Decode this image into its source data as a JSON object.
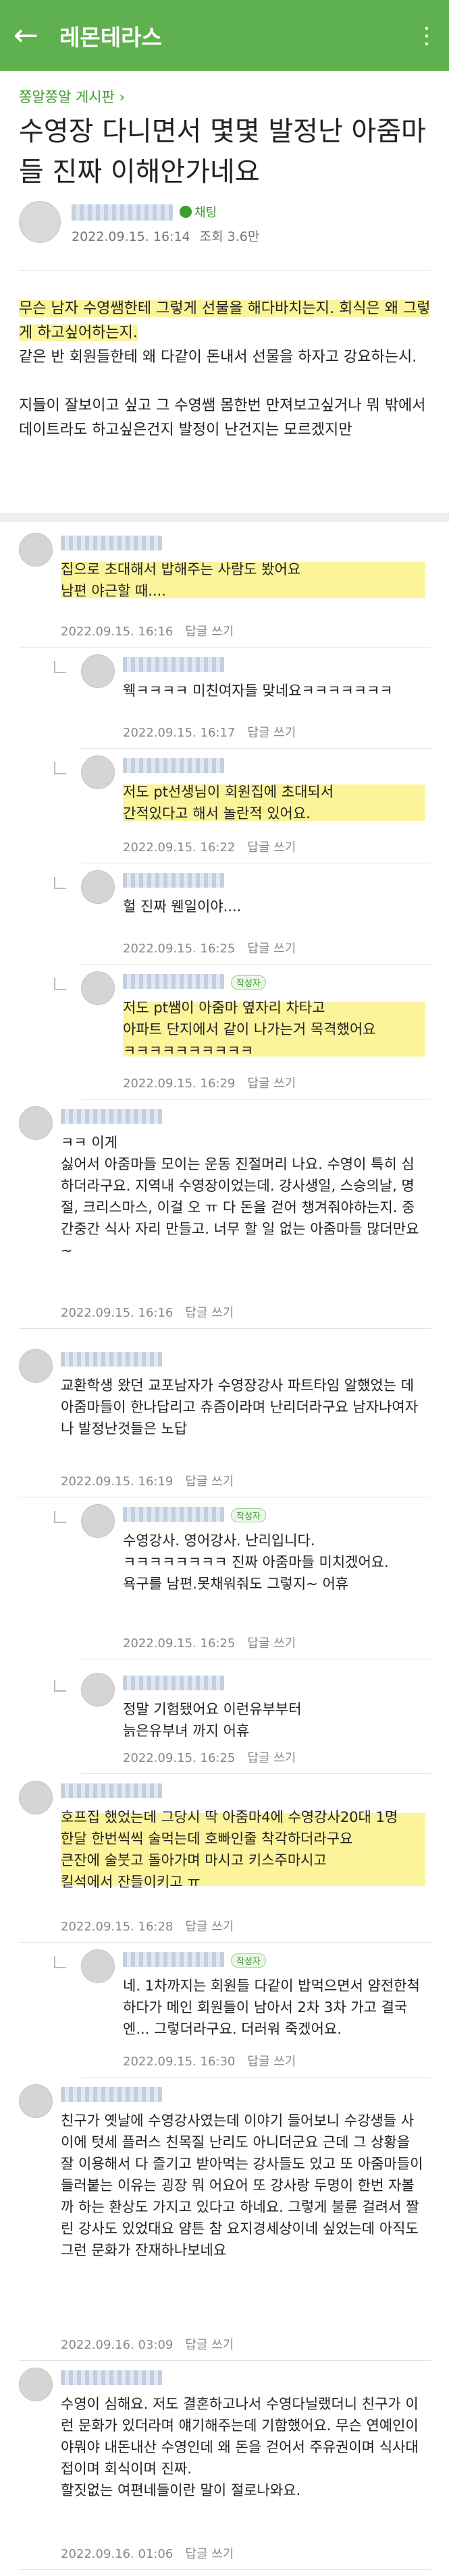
{
  "appbar": {
    "title": "레몬테라스",
    "back_icon": "arrow-left-icon",
    "more_icon": "kebab-menu-icon"
  },
  "post": {
    "board": "쫑알쫑알 게시판 ›",
    "title": "수영장 다니면서 몇몇 발정난 아줌마들 진짜 이해안가네요",
    "chat_label": "채팅",
    "date": "2022.09.15. 16:14",
    "views": "조회 3.6만",
    "body": [
      "무슨 남자 수영쌤한테 그렇게 선물을 해다바치는지. 회식은 왜 그렇게 하고싶어하는지.",
      "같은 반 회원들한테 왜 다같이 돈내서 선물을 하자고 강요하는시.",
      "지들이 잘보이고 싶고 그 수영쌤 몸한번 만져보고싶거나 뭐 밖에서 데이트라도 하고싶은건지 발정이 난건지는 모르겠지만"
    ]
  },
  "comments": [
    {
      "text": "집으로 초대해서 밥해주는 사람도 봤어요\n남편 야근할 때....",
      "date": "2022.09.15. 16:16",
      "reply": "답글 쓰기",
      "nested": false,
      "badge": ""
    },
    {
      "text": "웩ㅋㅋㅋㅋ 미친여자들 맞네요ㅋㅋㅋㅋㅋㅋㅋ",
      "date": "2022.09.15. 16:17",
      "reply": "답글 쓰기",
      "nested": true,
      "badge": ""
    },
    {
      "text": "저도 pt선생님이 회원집에 초대되서\n간적있다고 해서 놀란적 있어요.",
      "date": "2022.09.15. 16:22",
      "reply": "답글 쓰기",
      "nested": true,
      "badge": ""
    },
    {
      "text": "헐 진짜 웬일이야....",
      "date": "2022.09.15. 16:25",
      "reply": "답글 쓰기",
      "nested": true,
      "badge": ""
    },
    {
      "text": "저도 pt쌤이 아줌마 옆자리 차타고\n아파트 단지에서 같이 나가는거 목격했어요\nㅋㅋㅋㅋㅋㅋㅋㅋㅋㅋ",
      "date": "2022.09.15. 16:29",
      "reply": "답글 쓰기",
      "nested": true,
      "badge": "작성자"
    },
    {
      "text": "ㅋㅋ 이게\n싫어서 아줌마들 모이는 운동 진절머리 나요. 수영이 특히 심하더라구요. 지역내 수영장이었는데. 강사생일, 스승의날, 명절, 크리스마스, 이걸 오 ㅠ 다 돈을 걷어 챙겨줘야하는지. 중간중간 식사 자리 만들고. 너무 할 일 없는 아줌마들 많더만요~",
      "date": "2022.09.15. 16:16",
      "reply": "답글 쓰기",
      "nested": false,
      "badge": ""
    },
    {
      "text": "교환학생 왔던 교포남자가 수영장강사 파트타임 알했었는 데 아줌마들이 한나답리고 츄즘이라며 난리더라구요 남자나여자나 발정난것들은 노답",
      "date": "2022.09.15. 16:19",
      "reply": "답글 쓰기",
      "nested": false,
      "badge": ""
    },
    {
      "text": "수영강사. 영어강사. 난리입니다.\nㅋㅋㅋㅋㅋㅋㅋㅋ 진짜 아줌마들 미치겠어요.\n욕구를 남편.못채워줘도 그렇지~ 어휴",
      "date": "2022.09.15. 16:25",
      "reply": "답글 쓰기",
      "nested": true,
      "badge": "작성자"
    },
    {
      "text": "정말 기험됐어요 이런유부부터\n늙은유부녀 까지 어휴",
      "date": "2022.09.15. 16:25",
      "reply": "답글 쓰기",
      "nested": true,
      "badge": ""
    },
    {
      "text": "호프집 했었는데 그당시 딱 아줌마4에 수영강사20대 1명\n한달 한번씩씩 술먹는데 호빠인줄 착각하더라구요\n큰잔에 술붓고 돌아가며 마시고 키스주마시고\n킬석에서 잔들이키고 ㅠ",
      "date": "2022.09.15. 16:28",
      "reply": "답글 쓰기",
      "nested": false,
      "badge": ""
    },
    {
      "text": "네. 1차까지는 회원들 다같이 밥먹으면서 얌전한척 하다가 메인 회원들이 남아서 2차 3차 가고 결국엔... 그렇더라구요. 더러워 죽겠어요.",
      "date": "2022.09.15. 16:30",
      "reply": "답글 쓰기",
      "nested": true,
      "badge": "작성자"
    },
    {
      "text": "친구가 옛날에 수영강사였는데 이야기 들어보니 수강생들 사이에 텃세 플러스 친목질 난리도 아니더군요 근데 그 상황을 잘 이용해서 다 즐기고 받아먹는 강사들도 있고 또 아줌마들이 들러붙는 이유는 굉장 뭐 어요어 또 강사랑 두명이 한번 자볼까 하는 환상도 가지고 있다고 하네요. 그렇게 불륜 걸려서 짤린 강사도 있었대요 얌튼 참 요지경세상이네 싶었는데 아직도 그런 문화가 잔재하나보네요",
      "date": "2022.09.16. 03:09",
      "reply": "답글 쓰기",
      "nested": false,
      "badge": ""
    },
    {
      "text": "수영이 심해요. 저도 결혼하고나서 수영다닐랬더니 친구가 이런 문화가 있더라며 얘기해주는데 기함했어요. 무슨 연예인이야뭐야 내돈내산 수영인데 왜 돈을 걷어서 주유권이며 식사대접이며 회식이며 진짜.\n할짓없는 여편네들이란 말이 절로나와요.",
      "date": "2022.09.16. 01:06",
      "reply": "답글 쓰기",
      "nested": false,
      "badge": ""
    }
  ]
}
